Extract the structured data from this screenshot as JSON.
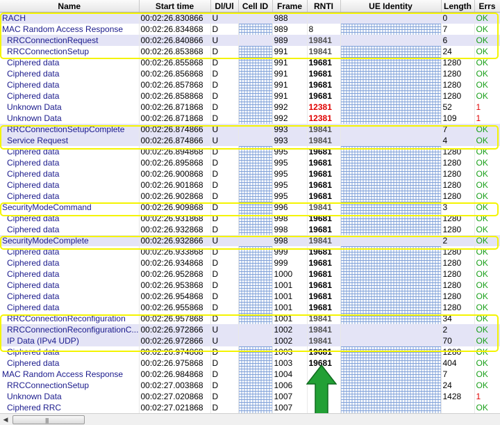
{
  "columns": [
    "Name",
    "Start time",
    "Dl/Ul",
    "Cell ID",
    "Frame",
    "RNTI",
    "UE Identity",
    "Length",
    "Errs"
  ],
  "rows": [
    {
      "name": "RACH",
      "time": "00:02:26.830866",
      "dir": "U",
      "frame": "988",
      "rnti": "",
      "len": "0",
      "errs": "OK",
      "indent": false,
      "hl": true,
      "rstyle": ""
    },
    {
      "name": "MAC Random Access Response",
      "time": "00:02:26.834868",
      "dir": "D",
      "frame": "989",
      "rnti": "8",
      "len": "7",
      "errs": "OK",
      "indent": false,
      "hl": false,
      "rstyle": "plain"
    },
    {
      "name": "RRCConnectionRequest",
      "time": "00:02:26.840866",
      "dir": "U",
      "frame": "989",
      "rnti": "19841",
      "len": "6",
      "errs": "OK",
      "indent": true,
      "hl": true,
      "rstyle": "gray"
    },
    {
      "name": "RRCConnectionSetup",
      "time": "00:02:26.853868",
      "dir": "D",
      "frame": "991",
      "rnti": "19841",
      "len": "24",
      "errs": "OK",
      "indent": true,
      "hl": false,
      "rstyle": "gray"
    },
    {
      "name": "Ciphered data",
      "time": "00:02:26.855868",
      "dir": "D",
      "frame": "991",
      "rnti": "19681",
      "len": "1280",
      "errs": "OK",
      "indent": true,
      "hl": false,
      "rstyle": ""
    },
    {
      "name": "Ciphered data",
      "time": "00:02:26.856868",
      "dir": "D",
      "frame": "991",
      "rnti": "19681",
      "len": "1280",
      "errs": "OK",
      "indent": true,
      "hl": false,
      "rstyle": ""
    },
    {
      "name": "Ciphered data",
      "time": "00:02:26.857868",
      "dir": "D",
      "frame": "991",
      "rnti": "19681",
      "len": "1280",
      "errs": "OK",
      "indent": true,
      "hl": false,
      "rstyle": ""
    },
    {
      "name": "Ciphered data",
      "time": "00:02:26.858868",
      "dir": "D",
      "frame": "991",
      "rnti": "19681",
      "len": "1280",
      "errs": "OK",
      "indent": true,
      "hl": false,
      "rstyle": ""
    },
    {
      "name": "Unknown Data",
      "time": "00:02:26.871868",
      "dir": "D",
      "frame": "992",
      "rnti": "12381",
      "len": "52",
      "errs": "1",
      "indent": true,
      "hl": false,
      "rstyle": "red"
    },
    {
      "name": "Unknown Data",
      "time": "00:02:26.871868",
      "dir": "D",
      "frame": "992",
      "rnti": "12381",
      "len": "109",
      "errs": "1",
      "indent": true,
      "hl": false,
      "rstyle": "red"
    },
    {
      "name": "RRCConnectionSetupComplete",
      "time": "00:02:26.874866",
      "dir": "U",
      "frame": "993",
      "rnti": "19841",
      "len": "7",
      "errs": "OK",
      "indent": true,
      "hl": true,
      "rstyle": "gray"
    },
    {
      "name": "Service Request",
      "time": "00:02:26.874866",
      "dir": "U",
      "frame": "993",
      "rnti": "19841",
      "len": "4",
      "errs": "OK",
      "indent": true,
      "hl": true,
      "rstyle": "gray"
    },
    {
      "name": "Ciphered data",
      "time": "00:02:26.894868",
      "dir": "D",
      "frame": "995",
      "rnti": "19681",
      "len": "1280",
      "errs": "OK",
      "indent": true,
      "hl": false,
      "rstyle": ""
    },
    {
      "name": "Ciphered data",
      "time": "00:02:26.895868",
      "dir": "D",
      "frame": "995",
      "rnti": "19681",
      "len": "1280",
      "errs": "OK",
      "indent": true,
      "hl": false,
      "rstyle": ""
    },
    {
      "name": "Ciphered data",
      "time": "00:02:26.900868",
      "dir": "D",
      "frame": "995",
      "rnti": "19681",
      "len": "1280",
      "errs": "OK",
      "indent": true,
      "hl": false,
      "rstyle": ""
    },
    {
      "name": "Ciphered data",
      "time": "00:02:26.901868",
      "dir": "D",
      "frame": "995",
      "rnti": "19681",
      "len": "1280",
      "errs": "OK",
      "indent": true,
      "hl": false,
      "rstyle": ""
    },
    {
      "name": "Ciphered data",
      "time": "00:02:26.902868",
      "dir": "D",
      "frame": "995",
      "rnti": "19681",
      "len": "1280",
      "errs": "OK",
      "indent": true,
      "hl": false,
      "rstyle": ""
    },
    {
      "name": "SecurityModeCommand",
      "time": "00:02:26.909868",
      "dir": "D",
      "frame": "996",
      "rnti": "19841",
      "len": "3",
      "errs": "OK",
      "indent": false,
      "hl": false,
      "rstyle": "gray"
    },
    {
      "name": "Ciphered data",
      "time": "00:02:26.931868",
      "dir": "D",
      "frame": "998",
      "rnti": "19681",
      "len": "1280",
      "errs": "OK",
      "indent": true,
      "hl": false,
      "rstyle": ""
    },
    {
      "name": "Ciphered data",
      "time": "00:02:26.932868",
      "dir": "D",
      "frame": "998",
      "rnti": "19681",
      "len": "1280",
      "errs": "OK",
      "indent": true,
      "hl": false,
      "rstyle": ""
    },
    {
      "name": "SecurityModeComplete",
      "time": "00:02:26.932866",
      "dir": "U",
      "frame": "998",
      "rnti": "19841",
      "len": "2",
      "errs": "OK",
      "indent": false,
      "hl": true,
      "rstyle": "gray"
    },
    {
      "name": "Ciphered data",
      "time": "00:02:26.933868",
      "dir": "D",
      "frame": "999",
      "rnti": "19681",
      "len": "1280",
      "errs": "OK",
      "indent": true,
      "hl": false,
      "rstyle": ""
    },
    {
      "name": "Ciphered data",
      "time": "00:02:26.934868",
      "dir": "D",
      "frame": "999",
      "rnti": "19681",
      "len": "1280",
      "errs": "OK",
      "indent": true,
      "hl": false,
      "rstyle": ""
    },
    {
      "name": "Ciphered data",
      "time": "00:02:26.952868",
      "dir": "D",
      "frame": "1000",
      "rnti": "19681",
      "len": "1280",
      "errs": "OK",
      "indent": true,
      "hl": false,
      "rstyle": ""
    },
    {
      "name": "Ciphered data",
      "time": "00:02:26.953868",
      "dir": "D",
      "frame": "1001",
      "rnti": "19681",
      "len": "1280",
      "errs": "OK",
      "indent": true,
      "hl": false,
      "rstyle": ""
    },
    {
      "name": "Ciphered data",
      "time": "00:02:26.954868",
      "dir": "D",
      "frame": "1001",
      "rnti": "19681",
      "len": "1280",
      "errs": "OK",
      "indent": true,
      "hl": false,
      "rstyle": ""
    },
    {
      "name": "Ciphered data",
      "time": "00:02:26.955868",
      "dir": "D",
      "frame": "1001",
      "rnti": "19681",
      "len": "1280",
      "errs": "OK",
      "indent": true,
      "hl": false,
      "rstyle": ""
    },
    {
      "name": "RRCConnectionReconfiguration",
      "time": "00:02:26.957868",
      "dir": "D",
      "frame": "1001",
      "rnti": "19841",
      "len": "34",
      "errs": "OK",
      "indent": true,
      "hl": false,
      "rstyle": "gray"
    },
    {
      "name": "RRCConnectionReconfigurationC...",
      "time": "00:02:26.972866",
      "dir": "U",
      "frame": "1002",
      "rnti": "19841",
      "len": "2",
      "errs": "OK",
      "indent": true,
      "hl": true,
      "rstyle": "gray"
    },
    {
      "name": "IP Data (IPv4 UDP)",
      "time": "00:02:26.972866",
      "dir": "U",
      "frame": "1002",
      "rnti": "19841",
      "len": "70",
      "errs": "OK",
      "indent": true,
      "hl": true,
      "rstyle": "gray"
    },
    {
      "name": "Ciphered data",
      "time": "00:02:26.974868",
      "dir": "D",
      "frame": "1003",
      "rnti": "19681",
      "len": "1280",
      "errs": "OK",
      "indent": true,
      "hl": false,
      "rstyle": ""
    },
    {
      "name": "Ciphered data",
      "time": "00:02:26.975868",
      "dir": "D",
      "frame": "1003",
      "rnti": "19681",
      "len": "404",
      "errs": "OK",
      "indent": true,
      "hl": false,
      "rstyle": ""
    },
    {
      "name": "MAC Random Access Response",
      "time": "00:02:26.984868",
      "dir": "D",
      "frame": "1004",
      "rnti": "",
      "len": "7",
      "errs": "OK",
      "indent": false,
      "hl": false,
      "rstyle": ""
    },
    {
      "name": "RRCConnectionSetup",
      "time": "00:02:27.003868",
      "dir": "D",
      "frame": "1006",
      "rnti": "",
      "len": "24",
      "errs": "OK",
      "indent": true,
      "hl": false,
      "rstyle": ""
    },
    {
      "name": "Unknown Data",
      "time": "00:02:27.020868",
      "dir": "D",
      "frame": "1007",
      "rnti": "",
      "len": "1428",
      "errs": "1",
      "indent": true,
      "hl": false,
      "rstyle": ""
    },
    {
      "name": "Ciphered RRC",
      "time": "00:02:27.021868",
      "dir": "D",
      "frame": "1007",
      "rnti": "",
      "len": "",
      "errs": "OK",
      "indent": true,
      "hl": false,
      "rstyle": ""
    }
  ],
  "colors": {
    "highlight_box": "#f4f400",
    "arrow": "#22a035",
    "ok": "#1aa01a",
    "error": "#e00000"
  },
  "scrollbar": {
    "left_arrow": "◀",
    "grip": "||||"
  }
}
